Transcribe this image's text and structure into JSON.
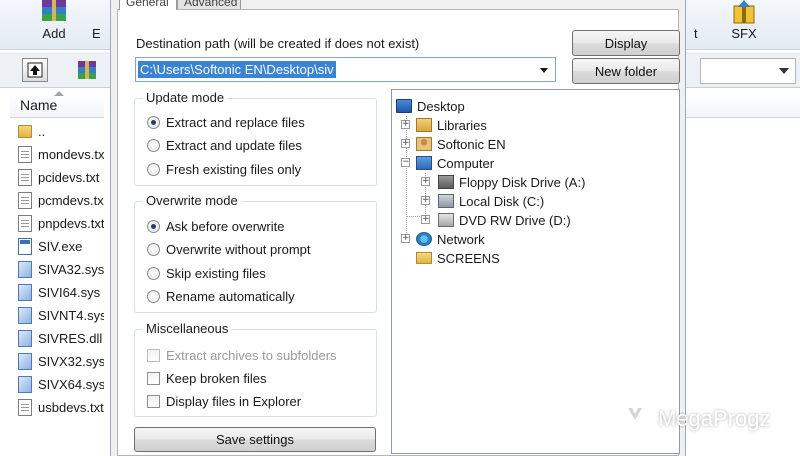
{
  "toolbar": {
    "add_label": "Add",
    "partial_left_label": "E",
    "partial_right_label": "t",
    "sfx_label": "SFX"
  },
  "file_list": {
    "column_name": "Name",
    "items": [
      {
        "name": "..",
        "type": "folder"
      },
      {
        "name": "mondevs.txt",
        "type": "doc"
      },
      {
        "name": "pcidevs.txt",
        "type": "doc"
      },
      {
        "name": "pcmdevs.txt",
        "type": "doc"
      },
      {
        "name": "pnpdevs.txt",
        "type": "doc"
      },
      {
        "name": "SIV.exe",
        "type": "exe"
      },
      {
        "name": "SIVA32.sys",
        "type": "sys"
      },
      {
        "name": "SIVI64.sys",
        "type": "sys"
      },
      {
        "name": "SIVNT4.sys",
        "type": "sys"
      },
      {
        "name": "SIVRES.dll",
        "type": "sys"
      },
      {
        "name": "SIVX32.sys",
        "type": "sys"
      },
      {
        "name": "SIVX64.sys",
        "type": "sys"
      },
      {
        "name": "usbdevs.txt",
        "type": "doc"
      }
    ]
  },
  "dialog": {
    "tabs": [
      "General",
      "Advanced"
    ],
    "dest_label": "Destination path (will be created if does not exist)",
    "dest_value": "C:\\Users\\Softonic EN\\Desktop\\siv",
    "display_button": "Display",
    "new_folder_button": "New folder",
    "update_mode": {
      "title": "Update mode",
      "options": [
        "Extract and replace files",
        "Extract and update files",
        "Fresh existing files only"
      ],
      "selected": 0
    },
    "overwrite_mode": {
      "title": "Overwrite mode",
      "options": [
        "Ask before overwrite",
        "Overwrite without prompt",
        "Skip existing files",
        "Rename automatically"
      ],
      "selected": 0
    },
    "misc": {
      "title": "Miscellaneous",
      "options": [
        {
          "label": "Extract archives to subfolders",
          "checked": false,
          "enabled": false
        },
        {
          "label": "Keep broken files",
          "checked": false,
          "enabled": true
        },
        {
          "label": "Display files in Explorer",
          "checked": false,
          "enabled": true
        }
      ]
    },
    "save_button": "Save settings",
    "tree": [
      {
        "label": "Desktop",
        "icon": "desktop-icon"
      },
      {
        "label": "Libraries",
        "icon": "libraries-icon"
      },
      {
        "label": "Softonic EN",
        "icon": "user-folder-icon"
      },
      {
        "label": "Computer",
        "icon": "computer-icon"
      },
      {
        "label": "Floppy Disk Drive (A:)",
        "icon": "floppy-drive-icon"
      },
      {
        "label": "Local Disk (C:)",
        "icon": "local-disk-icon"
      },
      {
        "label": "DVD RW Drive (D:)",
        "icon": "dvd-drive-icon"
      },
      {
        "label": "Network",
        "icon": "network-icon"
      },
      {
        "label": "SCREENS",
        "icon": "folder-icon"
      }
    ]
  },
  "watermark": {
    "text": "MegaProgz"
  }
}
